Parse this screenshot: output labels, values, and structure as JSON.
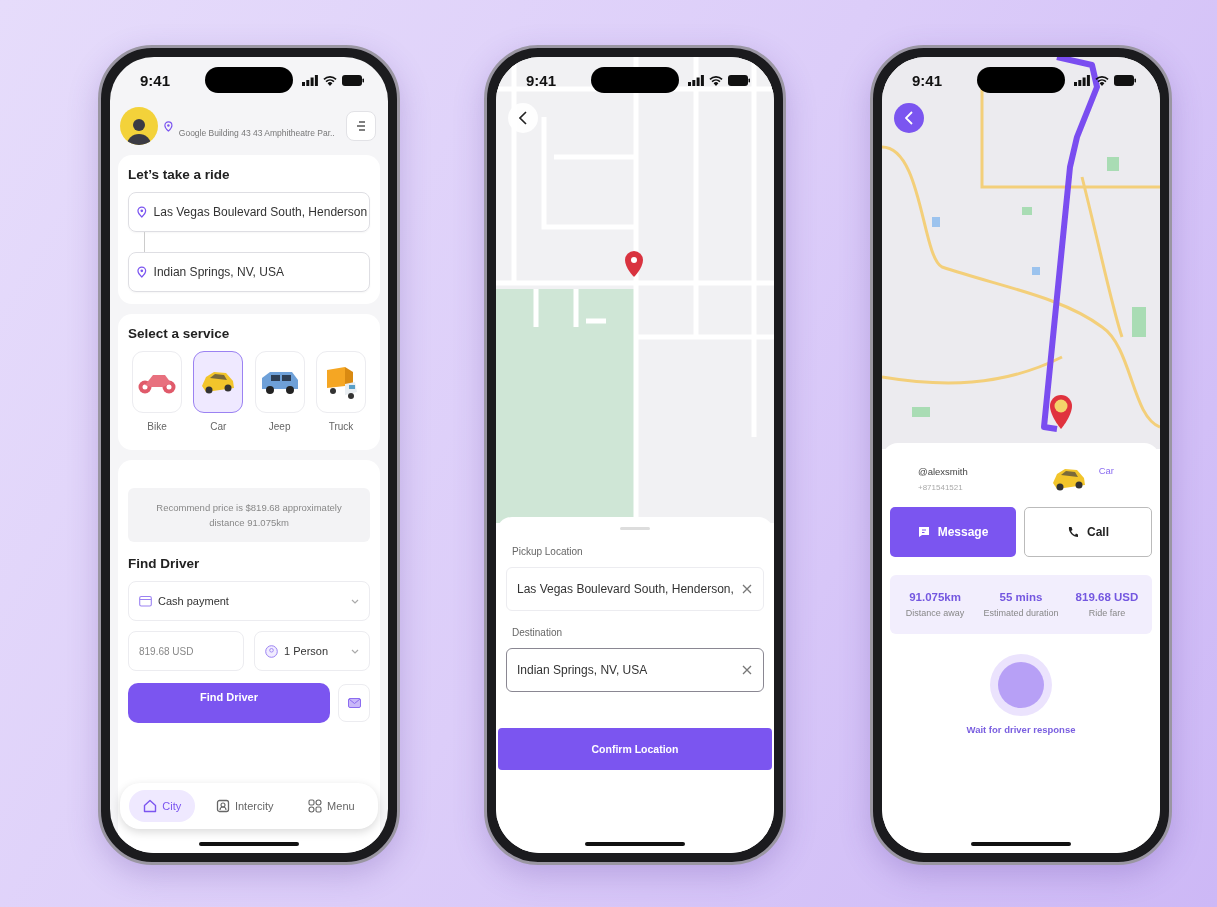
{
  "home_screen": {
    "status_time": "9:41",
    "location": "Google Building 43 43 Amphitheatre Par..",
    "ride_card": {
      "title": "Let’s take a ride",
      "pickup": "Las Vegas Boulevard South, Henderson",
      "destination": "Indian Springs, NV, USA"
    },
    "services": {
      "title": "Select a service",
      "items": [
        {
          "kind": "bike",
          "label": "Bike",
          "selected": false
        },
        {
          "kind": "car",
          "label": "Car",
          "selected": true
        },
        {
          "kind": "jeep",
          "label": "Jeep",
          "selected": false
        },
        {
          "kind": "truck",
          "label": "Truck",
          "selected": false
        }
      ]
    },
    "find_card": {
      "note": "Recommend price is $819.68 approximately distance 91.075km",
      "title": "Find Driver",
      "payment": "Cash payment",
      "price": "819.68 USD",
      "persons": "1 Person",
      "button": "Find Driver"
    },
    "nav": [
      {
        "kind": "home",
        "label": "City",
        "selected": true
      },
      {
        "kind": "card",
        "label": "Intercity",
        "selected": false
      },
      {
        "kind": "grid",
        "label": "Menu",
        "selected": false
      }
    ]
  },
  "map_picker_screen": {
    "status_time": "9:41",
    "fields": [
      {
        "label": "Pickup Location",
        "value": "Las Vegas Boulevard South, Henderson,",
        "focused": false
      },
      {
        "label": "Destination",
        "value": "Indian Springs, NV, USA",
        "focused": true
      }
    ],
    "button": "Confirm Location"
  },
  "driver_screen": {
    "status_time": "9:41",
    "driver": {
      "handle": "@alexsmith",
      "phone": "+871541521"
    },
    "vehicle": "Car",
    "message_button": "Message",
    "call_button": "Call",
    "stats": [
      {
        "value": "91.075km",
        "label": "Distance away"
      },
      {
        "value": "55 mins",
        "label": "Estimated duration"
      },
      {
        "value": "819.68 USD",
        "label": "Ride fare"
      }
    ],
    "status": "Wait for driver response"
  }
}
